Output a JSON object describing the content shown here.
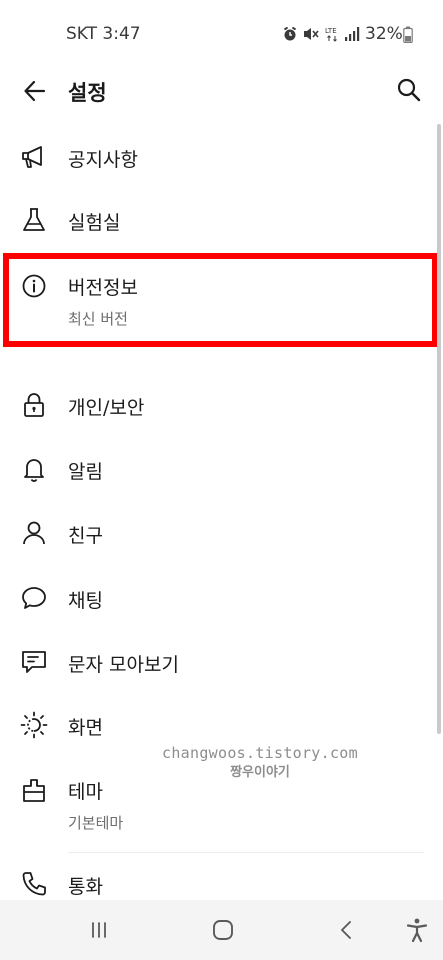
{
  "status_bar": {
    "carrier_time": "SKT 3:47",
    "battery_percent": "32%",
    "icons": [
      "alarm-icon",
      "mute-icon",
      "lte-icon",
      "signal-icon",
      "battery-icon"
    ]
  },
  "header": {
    "title": "설정",
    "back_icon": "arrow-left-icon",
    "search_icon": "search-icon"
  },
  "menu": [
    {
      "id": "notice",
      "label": "공지사항",
      "icon": "megaphone-icon"
    },
    {
      "id": "lab",
      "label": "실험실",
      "icon": "flask-icon"
    },
    {
      "id": "version",
      "label": "버전정보",
      "sub": "최신 버전",
      "icon": "info-icon",
      "highlighted": true
    },
    {
      "id": "privacy",
      "label": "개인/보안",
      "icon": "lock-icon"
    },
    {
      "id": "notifications",
      "label": "알림",
      "icon": "bell-icon"
    },
    {
      "id": "friends",
      "label": "친구",
      "icon": "person-icon"
    },
    {
      "id": "chat",
      "label": "채팅",
      "icon": "chat-bubble-icon"
    },
    {
      "id": "sms",
      "label": "문자 모아보기",
      "icon": "message-icon"
    },
    {
      "id": "display",
      "label": "화면",
      "icon": "brightness-icon"
    },
    {
      "id": "theme",
      "label": "테마",
      "sub": "기본테마",
      "icon": "theme-icon"
    },
    {
      "id": "call",
      "label": "통화",
      "icon": "phone-icon"
    }
  ],
  "watermark": {
    "line1": "changwoos.tistory.com",
    "line2": "짱우이야기"
  },
  "nav_bar": [
    "recent-apps-icon",
    "home-icon",
    "back-icon",
    "accessibility-icon"
  ],
  "colors": {
    "highlight": "#ff0000",
    "text": "#1c1c1c",
    "subtext": "#6e6e6e",
    "nav_bg": "#f4f4f4"
  }
}
